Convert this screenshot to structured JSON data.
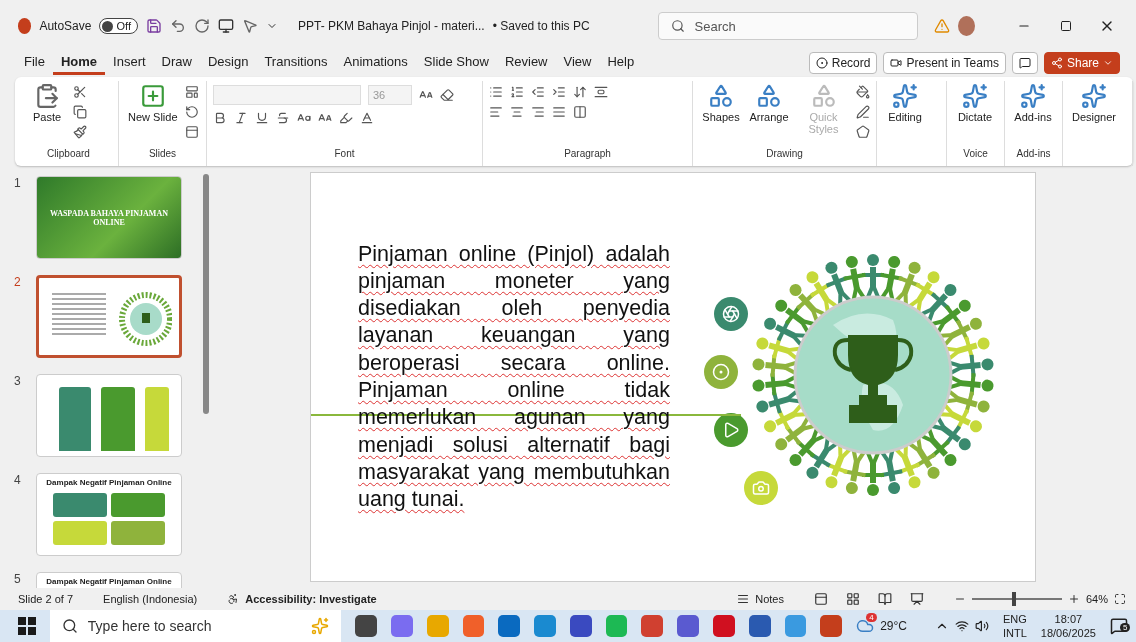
{
  "titlebar": {
    "autosave": "AutoSave",
    "autosave_toggle": {
      "on": false,
      "label": "Off"
    },
    "document_title": "PPT- PKM Bahaya Pinjol - materi...",
    "save_status": "• Saved to this PC",
    "search": {
      "placeholder": "Search"
    }
  },
  "menu": [
    {
      "label": "File",
      "selected": false
    },
    {
      "label": "Home",
      "selected": true
    },
    {
      "label": "Insert",
      "selected": false
    },
    {
      "label": "Draw",
      "selected": false
    },
    {
      "label": "Design",
      "selected": false
    },
    {
      "label": "Transitions",
      "selected": false
    },
    {
      "label": "Animations",
      "selected": false
    },
    {
      "label": "Slide Show",
      "selected": false
    },
    {
      "label": "Review",
      "selected": false
    },
    {
      "label": "View",
      "selected": false
    },
    {
      "label": "Help",
      "selected": false
    }
  ],
  "menu_buttons": [
    {
      "kind": "record",
      "label": "Record"
    },
    {
      "kind": "teams",
      "label": "Present in Teams"
    },
    {
      "kind": "comment"
    },
    {
      "kind": "share",
      "label": "Share"
    }
  ],
  "ribbon": {
    "groups": [
      {
        "kind": "clipboard",
        "label": "Clipboard",
        "buttons": [
          {
            "label": "Paste"
          }
        ]
      },
      {
        "kind": "slides",
        "label": "Slides",
        "buttons": [
          {
            "label": "New Slide"
          }
        ]
      },
      {
        "kind": "font",
        "label": "Font",
        "font_size": "36"
      },
      {
        "kind": "paragraph",
        "label": "Paragraph"
      },
      {
        "kind": "drawing",
        "label": "Drawing",
        "buttons": [
          {
            "label": "Shapes",
            "disabled": false
          },
          {
            "label": "Arrange",
            "disabled": false
          },
          {
            "label": "Quick Styles",
            "disabled": true
          }
        ]
      },
      {
        "kind": "large",
        "buttons": [
          {
            "label": "Editing",
            "disabled": false
          }
        ]
      },
      {
        "kind": "large",
        "label": "Voice",
        "buttons": [
          {
            "label": "Dictate",
            "disabled": false
          }
        ]
      },
      {
        "kind": "large",
        "label": "Add-ins",
        "buttons": [
          {
            "label": "Add-ins",
            "disabled": false
          }
        ]
      },
      {
        "kind": "large",
        "buttons": [
          {
            "label": "Designer",
            "disabled": false
          }
        ]
      }
    ]
  },
  "thumbnails": [
    {
      "number": "1",
      "selected": false,
      "kind": "title",
      "title": "WASPADA BAHAYA PINJAMAN ONLINE"
    },
    {
      "number": "2",
      "selected": true,
      "kind": "text_graphic"
    },
    {
      "number": "3",
      "selected": false,
      "kind": "columns"
    },
    {
      "number": "4",
      "selected": false,
      "kind": "grid",
      "title": "Dampak Negatif Pinjaman Online"
    },
    {
      "number": "5",
      "selected": false,
      "kind": "grid",
      "title": "Dampak Negatif Pinjaman Online"
    }
  ],
  "slide": {
    "text": "Pinjaman online (Pinjol) adalah pinjaman moneter yang disediakan oleh penyedia layanan keuangan yang beroperasi secara online. Pinjaman online tidak memerlukan agunan yang menjadi solusi alternatif bagi masyarakat yang membutuhkan uang tunai.",
    "side_icons": [
      {
        "color": "#3a8a6e"
      },
      {
        "color": "#8fb33c"
      },
      {
        "color": "#4a9a2e"
      },
      {
        "color": "#c6d93a"
      }
    ]
  },
  "status_bar": {
    "slide": "Slide 2 of 7",
    "language": "English (Indonesia)",
    "accessibility": "Accessibility: Investigate",
    "notes": "Notes",
    "zoom": "64%",
    "zoom_slider": {
      "level": 0.45
    }
  },
  "taskbar": {
    "search": {
      "placeholder": "Type here to search"
    },
    "weather": {
      "badge": "4",
      "temperature": "29°C"
    },
    "language": [
      "ENG",
      "INTL"
    ],
    "time": "18:07",
    "date": "18/06/2025",
    "notifications": "5"
  }
}
